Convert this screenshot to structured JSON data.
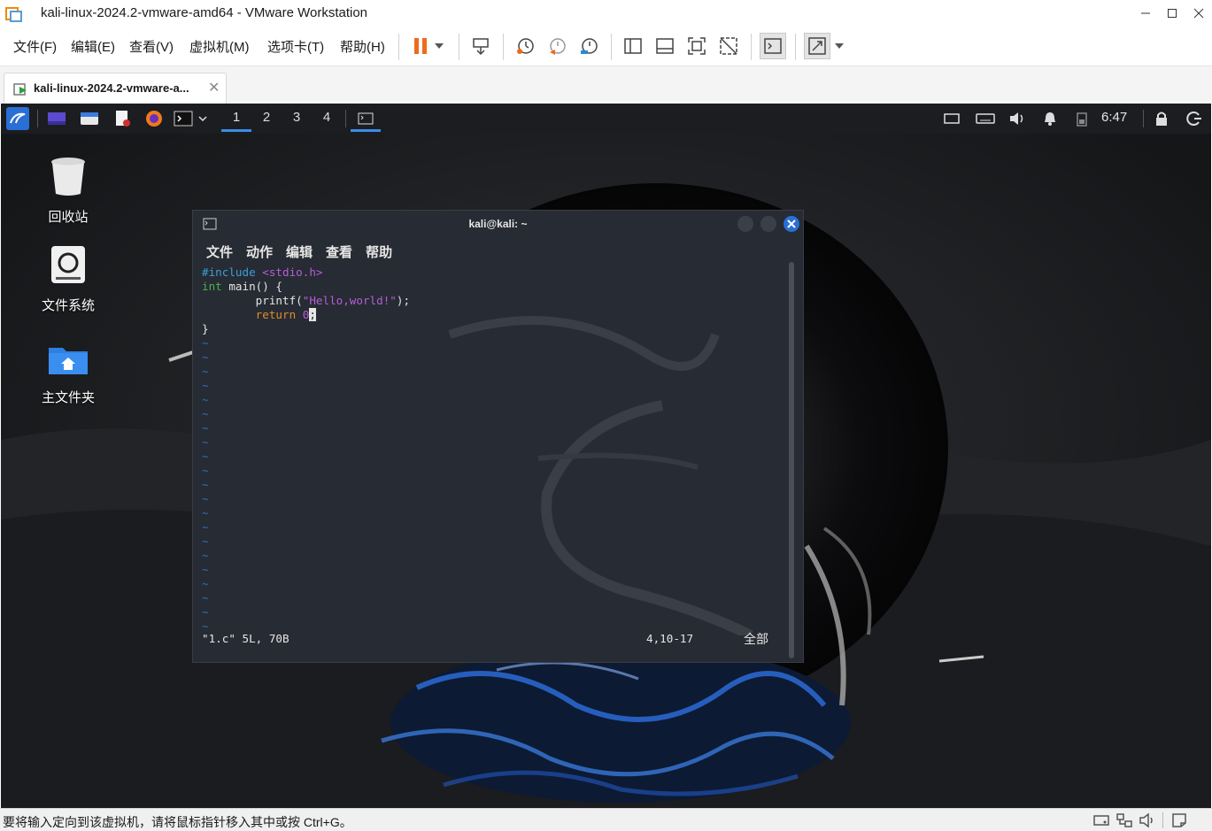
{
  "window": {
    "title": "kali-linux-2024.2-vmware-amd64 - VMware Workstation"
  },
  "menu": {
    "file": "文件(F)",
    "edit": "编辑(E)",
    "view": "查看(V)",
    "vm": "虚拟机(M)",
    "tabs": "选项卡(T)",
    "help": "帮助(H)"
  },
  "tab": {
    "label": "kali-linux-2024.2-vmware-a...",
    "close": "✕"
  },
  "panel": {
    "workspaces": [
      "1",
      "2",
      "3",
      "4"
    ],
    "active_workspace": "1",
    "clock": "6:47"
  },
  "desktop": {
    "trash_label": "回收站",
    "filesystem_label": "文件系统",
    "home_label": "主文件夹"
  },
  "terminal": {
    "title": "kali@kali: ~",
    "menu": {
      "file": "文件",
      "action": "动作",
      "edit": "编辑",
      "view": "查看",
      "help": "帮助"
    },
    "code": {
      "l1_pre": "#include",
      "l1_hdr": " <stdio.h>",
      "l2_type": "int",
      "l2_rest": " main() {",
      "l3_fn": "        printf(",
      "l3_str": "\"Hello,world!\"",
      "l3_end": ");",
      "l4_kw": "        return",
      "l4_val": " 0",
      "l4_cursor": ";",
      "l5": "}",
      "tilde": "~"
    },
    "status": {
      "file_info": "\"1.c\" 5L, 70B",
      "position": "4,10-17",
      "scope": "全部"
    }
  },
  "statusbar": {
    "message": "要将输入定向到该虚拟机，请将鼠标指针移入其中或按 Ctrl+G。"
  },
  "colors": {
    "panel_bg": "#1c1d21",
    "terminal_bg": "#272b33",
    "accent": "#3a8ce6",
    "close_btn": "#2a6fd6"
  }
}
